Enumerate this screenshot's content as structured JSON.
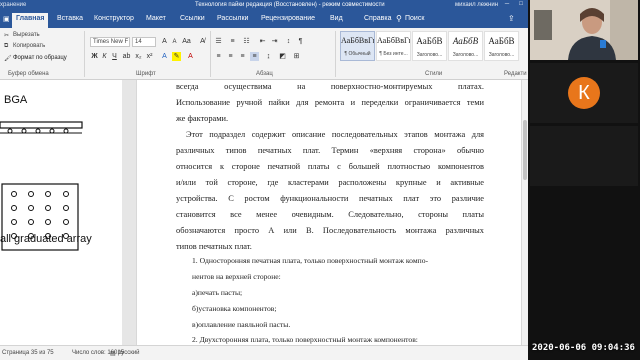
{
  "titlebar": {
    "left_label": "хранение",
    "title": "Технология пайки редакция (Восстановлен)  -  режим совместимости",
    "user": "михаил лежнин"
  },
  "tabs": [
    "Главная",
    "Вставка",
    "Конструктор",
    "Макет",
    "Ссылки",
    "Рассылки",
    "Рецензирование",
    "Вид",
    "Справка",
    "Поиск"
  ],
  "ribbon": {
    "clipboard": {
      "cut": "Вырезать",
      "copy": "Копировать",
      "format_painter": "Формат по образцу",
      "label": "Буфер обмена"
    },
    "font": {
      "name": "Times New F",
      "size": "14",
      "label": "Шрифт"
    },
    "paragraph": {
      "label": "Абзац"
    },
    "styles": {
      "label": "Стили",
      "items": [
        {
          "sample": "АаБбВвГг,",
          "name": "¶ Обычный"
        },
        {
          "sample": "АаБбВвГг,",
          "name": "¶ Без инте..."
        },
        {
          "sample": "АаБбВ",
          "name": "Заголово..."
        },
        {
          "sample": "АаБбВ",
          "name": "Заголово..."
        },
        {
          "sample": "АаБбВ",
          "name": "Заголово..."
        },
        {
          "sample": "АаБбВ",
          "name": "Заголово..."
        }
      ]
    },
    "edit_label": "Редакти"
  },
  "slide": {
    "title1": "BGA",
    "title2": "all graduated array"
  },
  "document": {
    "lines": [
      "всегда осуществима на поверхностно-монтируемых платах.",
      "Использование ручной пайки для ремонта и переделки ограничивается теми",
      "же факторами.",
      "Этот подраздел содержит описание последовательных этапов монтажа для",
      "различных типов печатных плат. Термин «верхняя сторона» обычно",
      "относится к стороне печатной платы с большей плотностью компонентов",
      "и/или той стороне, где кластерами расположены крупные и активные",
      "устройства. С ростом функциональности печатных плат это различие",
      "становится все менее очевидным. Следовательно, стороны платы",
      "обозначаются просто А или В. Последовательность монтажа различных",
      "типов печатных плат.",
      "1. Односторонняя печатная плата, только поверхностный монтаж компо-",
      "нентов на верхней стороне:",
      "а)печать пасты;",
      "б)установка компонентов;",
      "в)оплавление паяльной пасты.",
      "2. Двухсторонняя плата, только поверхностный монтаж компонентов:"
    ]
  },
  "status": {
    "page": "Страница 35 из 75",
    "words": "Число слов: 16015",
    "lang": "русский"
  },
  "video": {
    "participant_letter": "К",
    "timestamp": "2020-06-06  09:04:36"
  }
}
